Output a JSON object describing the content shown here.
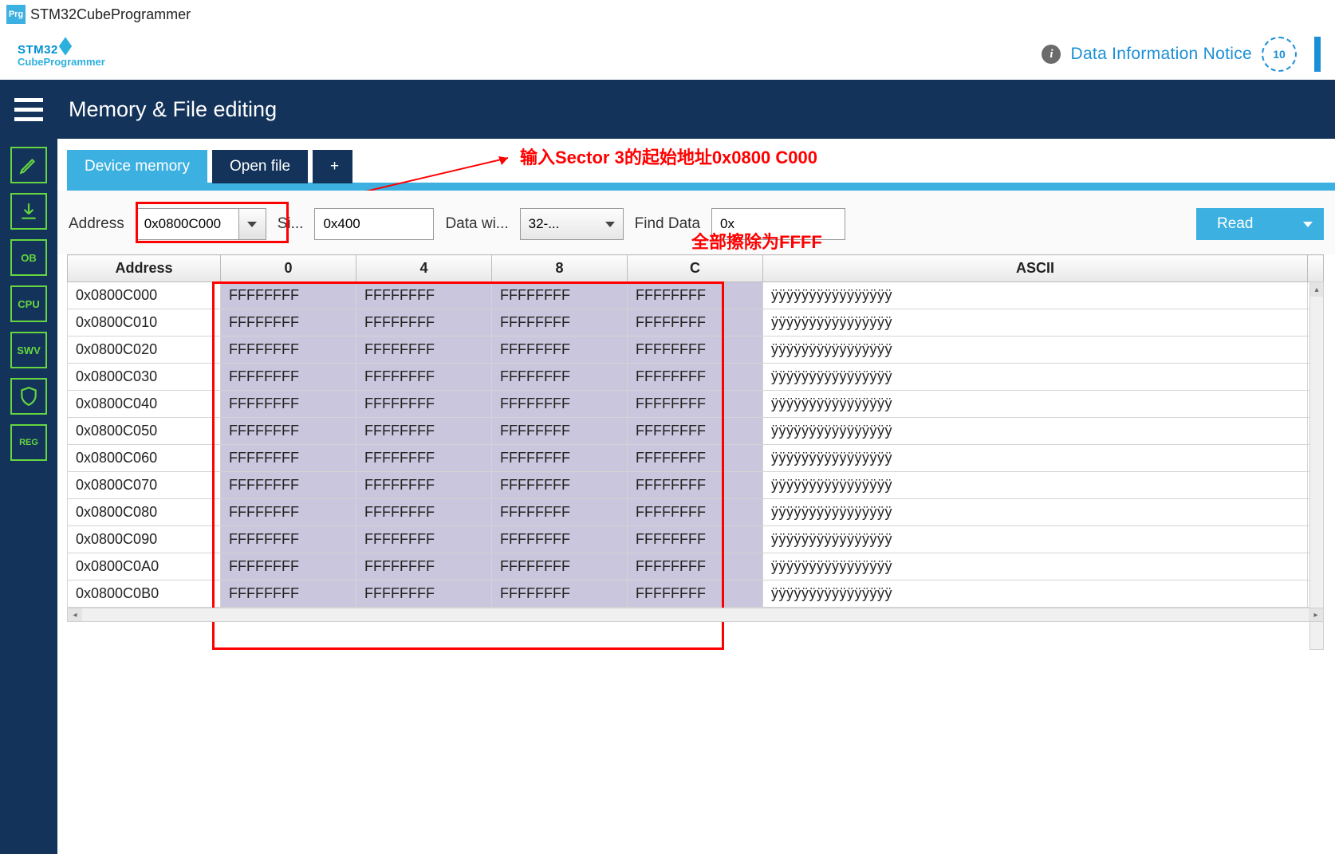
{
  "titlebar": {
    "icon_text": "Prg",
    "title": "STM32CubeProgrammer"
  },
  "logo": {
    "top": "STM32",
    "bottom": "CubeProgrammer"
  },
  "notice": {
    "text": "Data Information Notice",
    "badge": "10"
  },
  "header": {
    "title": "Memory & File editing"
  },
  "sidebar": {
    "items": [
      {
        "name": "edit",
        "label": ""
      },
      {
        "name": "download",
        "label": ""
      },
      {
        "name": "ob",
        "label": "OB"
      },
      {
        "name": "cpu",
        "label": "CPU"
      },
      {
        "name": "swv",
        "label": "SWV"
      },
      {
        "name": "shield",
        "label": ""
      },
      {
        "name": "reg",
        "label": "REG"
      }
    ]
  },
  "tabs": {
    "device_memory": "Device memory",
    "open_file": "Open file",
    "plus": "+"
  },
  "controls": {
    "address_label": "Address",
    "address_value": "0x0800C000",
    "size_label": "Si...",
    "size_value": "0x400",
    "datawidth_label": "Data wi...",
    "datawidth_value": "32-...",
    "find_label": "Find Data",
    "find_value": "0x",
    "read_label": "Read"
  },
  "table": {
    "headers": {
      "address": "Address",
      "c0": "0",
      "c4": "4",
      "c8": "8",
      "cC": "C",
      "ascii": "ASCII"
    },
    "rows": [
      {
        "addr": "0x0800C000",
        "v": [
          "FFFFFFFF",
          "FFFFFFFF",
          "FFFFFFFF",
          "FFFFFFFF"
        ],
        "ascii": "ÿÿÿÿÿÿÿÿÿÿÿÿÿÿÿÿ"
      },
      {
        "addr": "0x0800C010",
        "v": [
          "FFFFFFFF",
          "FFFFFFFF",
          "FFFFFFFF",
          "FFFFFFFF"
        ],
        "ascii": "ÿÿÿÿÿÿÿÿÿÿÿÿÿÿÿÿ"
      },
      {
        "addr": "0x0800C020",
        "v": [
          "FFFFFFFF",
          "FFFFFFFF",
          "FFFFFFFF",
          "FFFFFFFF"
        ],
        "ascii": "ÿÿÿÿÿÿÿÿÿÿÿÿÿÿÿÿ"
      },
      {
        "addr": "0x0800C030",
        "v": [
          "FFFFFFFF",
          "FFFFFFFF",
          "FFFFFFFF",
          "FFFFFFFF"
        ],
        "ascii": "ÿÿÿÿÿÿÿÿÿÿÿÿÿÿÿÿ"
      },
      {
        "addr": "0x0800C040",
        "v": [
          "FFFFFFFF",
          "FFFFFFFF",
          "FFFFFFFF",
          "FFFFFFFF"
        ],
        "ascii": "ÿÿÿÿÿÿÿÿÿÿÿÿÿÿÿÿ"
      },
      {
        "addr": "0x0800C050",
        "v": [
          "FFFFFFFF",
          "FFFFFFFF",
          "FFFFFFFF",
          "FFFFFFFF"
        ],
        "ascii": "ÿÿÿÿÿÿÿÿÿÿÿÿÿÿÿÿ"
      },
      {
        "addr": "0x0800C060",
        "v": [
          "FFFFFFFF",
          "FFFFFFFF",
          "FFFFFFFF",
          "FFFFFFFF"
        ],
        "ascii": "ÿÿÿÿÿÿÿÿÿÿÿÿÿÿÿÿ"
      },
      {
        "addr": "0x0800C070",
        "v": [
          "FFFFFFFF",
          "FFFFFFFF",
          "FFFFFFFF",
          "FFFFFFFF"
        ],
        "ascii": "ÿÿÿÿÿÿÿÿÿÿÿÿÿÿÿÿ"
      },
      {
        "addr": "0x0800C080",
        "v": [
          "FFFFFFFF",
          "FFFFFFFF",
          "FFFFFFFF",
          "FFFFFFFF"
        ],
        "ascii": "ÿÿÿÿÿÿÿÿÿÿÿÿÿÿÿÿ"
      },
      {
        "addr": "0x0800C090",
        "v": [
          "FFFFFFFF",
          "FFFFFFFF",
          "FFFFFFFF",
          "FFFFFFFF"
        ],
        "ascii": "ÿÿÿÿÿÿÿÿÿÿÿÿÿÿÿÿ"
      },
      {
        "addr": "0x0800C0A0",
        "v": [
          "FFFFFFFF",
          "FFFFFFFF",
          "FFFFFFFF",
          "FFFFFFFF"
        ],
        "ascii": "ÿÿÿÿÿÿÿÿÿÿÿÿÿÿÿÿ"
      },
      {
        "addr": "0x0800C0B0",
        "v": [
          "FFFFFFFF",
          "FFFFFFFF",
          "FFFFFFFF",
          "FFFFFFFF"
        ],
        "ascii": "ÿÿÿÿÿÿÿÿÿÿÿÿÿÿÿÿ"
      }
    ]
  },
  "annotations": {
    "anno1": "输入Sector 3的起始地址0x0800 C000",
    "anno2": "全部擦除为FFFF"
  }
}
